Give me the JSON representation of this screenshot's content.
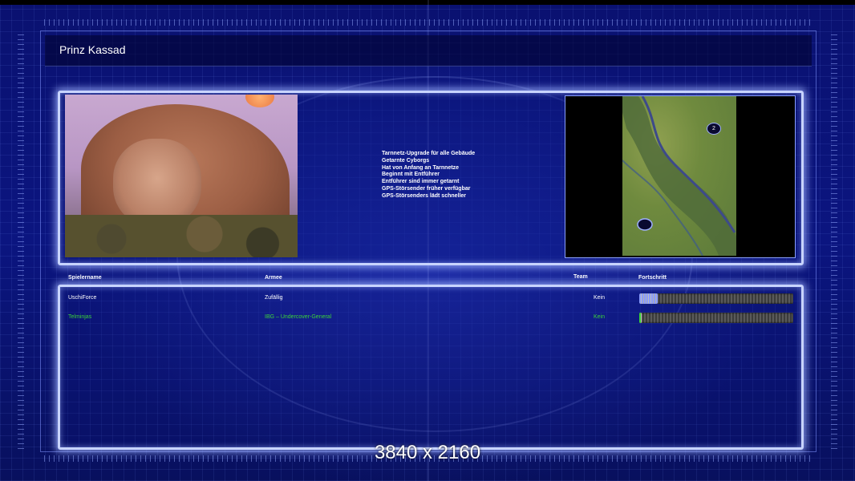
{
  "window": {
    "title": "Prinz Kassad"
  },
  "faction": {
    "upgrades": [
      "Tarnnetz-Upgrade für alle Gebäude",
      "Getarnte Cyborgs",
      "Hat von Anfang an Tarnnetze",
      "Beginnt mit Entführer",
      "Entführer sind immer getarnt",
      "GPS-Störsender früher verfügbar",
      "GPS-Störsenders lädt schneller"
    ]
  },
  "minimap": {
    "marker_label": "2"
  },
  "table": {
    "headers": {
      "name": "Spielername",
      "army": "Armee",
      "team": "Team",
      "progress": "Fortschritt"
    },
    "rows": [
      {
        "name": "UschiForce",
        "army": "Zufällig",
        "team": "Kein",
        "progress": 0.12,
        "color": "#ffffff",
        "bar_color": "#8a9cff"
      },
      {
        "name": "Telminjas",
        "army": "IBG – Undercover-General",
        "team": "Kein",
        "progress": 0.015,
        "color": "#3ad23a",
        "bar_color": "#3ad23a"
      }
    ]
  },
  "overlay": {
    "resolution": "3840 x 2160"
  },
  "colors": {
    "panel_border": "#c8d4ff",
    "background": "#0a0f5a",
    "accent_green": "#3ad23a"
  }
}
